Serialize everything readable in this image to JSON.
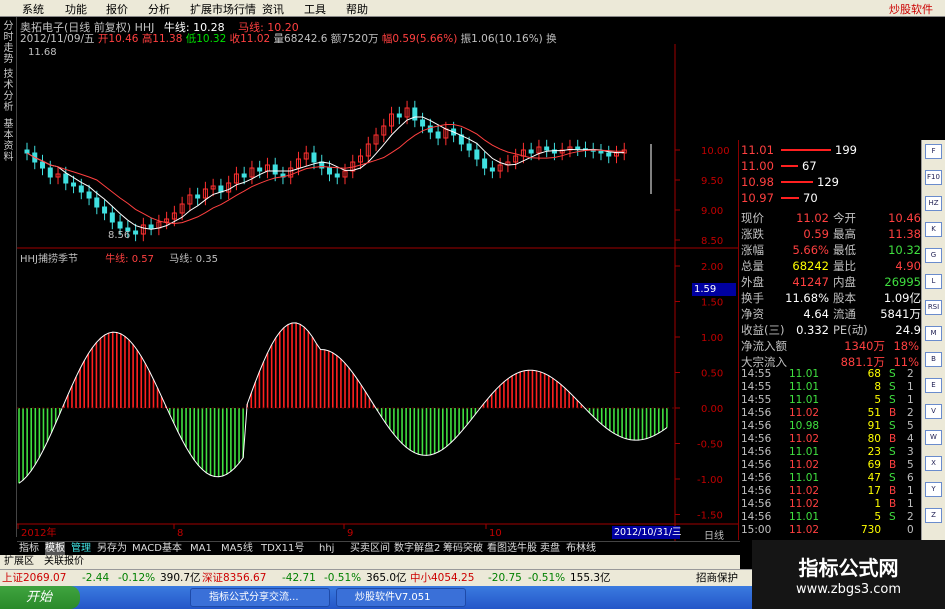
{
  "menu": {
    "items": [
      "系统",
      "功能",
      "报价",
      "分析",
      "扩展市场行情",
      "资讯",
      "工具",
      "帮助"
    ],
    "brand": "炒股软件"
  },
  "info_line1": {
    "stock": "奥拓电子(日线 前复权) HHJ",
    "ma_label": "牛线: 10.28",
    "ma2_label": "马线: 10.20"
  },
  "info_line2": {
    "date": "2012/11/09/五",
    "open": "开10.46",
    "high": "高11.38",
    "low": "低10.32",
    "close": "收11.02",
    "volume": "量68242.6",
    "amount": "额7520万",
    "change": "幅0.59(5.66%)",
    "amplitude": "振1.06(10.16%)",
    "extra": "换"
  },
  "left_tabs": [
    "分时走势",
    "技术分析",
    "基本资料"
  ],
  "price_axis": [
    "10.00",
    "9.50",
    "9.00",
    "8.50"
  ],
  "indicator_axis": [
    "2.00",
    "1.50",
    "1.00",
    "0.50",
    "0.00",
    "-0.50",
    "-1.00",
    "-1.50"
  ],
  "indicator_current": "1.59",
  "chart_labels": {
    "high_mark": "11.68",
    "low_mark": "8.56",
    "indicator_title": "HHJ捕捞季节",
    "ind_bull": "牛线: 0.57",
    "ind_horse": "马线: 0.35"
  },
  "x_axis": {
    "labels": [
      "2012年",
      "8",
      "9",
      "10"
    ],
    "date_box": "2012/10/31/三",
    "period": "日线"
  },
  "order_book": [
    {
      "price": "11.01",
      "vol": "199"
    },
    {
      "price": "11.00",
      "vol": "67"
    },
    {
      "price": "10.98",
      "vol": "129"
    },
    {
      "price": "10.97",
      "vol": "70"
    }
  ],
  "quote": [
    {
      "l1": "现价",
      "v1": "11.02",
      "l2": "今开",
      "v2": "10.46"
    },
    {
      "l1": "涨跌",
      "v1": "0.59",
      "l2": "最高",
      "v2": "11.38"
    },
    {
      "l1": "涨幅",
      "v1": "5.66%",
      "l2": "最低",
      "v2": "10.32"
    },
    {
      "l1": "总量",
      "v1": "68242",
      "l2": "量比",
      "v2": "4.90"
    },
    {
      "l1": "外盘",
      "v1": "41247",
      "l2": "内盘",
      "v2": "26995"
    }
  ],
  "quote2": [
    {
      "l1": "换手",
      "v1": "11.68%",
      "l2": "股本",
      "v2": "1.09亿"
    },
    {
      "l1": "净资",
      "v1": "4.64",
      "l2": "流通",
      "v2": "5841万"
    },
    {
      "l1": "收益(三)",
      "v1": "0.332",
      "l2": "PE(动)",
      "v2": "24.9"
    }
  ],
  "flows": [
    {
      "label": "净流入额",
      "value": "1340万",
      "pct": "18%"
    },
    {
      "label": "大宗流入",
      "value": "881.1万",
      "pct": "11%"
    }
  ],
  "ticks": [
    {
      "t": "14:55",
      "p": "11.01",
      "v": "68",
      "s": "S",
      "n": "2"
    },
    {
      "t": "14:55",
      "p": "11.01",
      "v": "8",
      "s": "S",
      "n": "1"
    },
    {
      "t": "14:55",
      "p": "11.01",
      "v": "5",
      "s": "S",
      "n": "1"
    },
    {
      "t": "14:56",
      "p": "11.02",
      "v": "51",
      "s": "B",
      "n": "2"
    },
    {
      "t": "14:56",
      "p": "10.98",
      "v": "91",
      "s": "S",
      "n": "5"
    },
    {
      "t": "14:56",
      "p": "11.02",
      "v": "80",
      "s": "B",
      "n": "4"
    },
    {
      "t": "14:56",
      "p": "11.01",
      "v": "23",
      "s": "S",
      "n": "3"
    },
    {
      "t": "14:56",
      "p": "11.02",
      "v": "69",
      "s": "B",
      "n": "5"
    },
    {
      "t": "14:56",
      "p": "11.01",
      "v": "47",
      "s": "S",
      "n": "6"
    },
    {
      "t": "14:56",
      "p": "11.02",
      "v": "17",
      "s": "B",
      "n": "1"
    },
    {
      "t": "14:56",
      "p": "11.02",
      "v": "1",
      "s": "B",
      "n": "1"
    },
    {
      "t": "14:56",
      "p": "11.01",
      "v": "5",
      "s": "S",
      "n": "2"
    },
    {
      "t": "15:00",
      "p": "11.02",
      "v": "730",
      "s": "",
      "n": "0"
    }
  ],
  "tabs": [
    "指标",
    "模板",
    "管理",
    "另存为",
    "MACD基本",
    "MA1",
    "MA5线",
    "TDX11号",
    "hhj",
    "买卖区间",
    "数字解盘2",
    "筹码突破",
    "看图选牛股",
    "卖盘",
    "布林线"
  ],
  "subtabs": [
    "扩展区",
    "关联报价"
  ],
  "status": {
    "sh": "上证2069.07",
    "sh_chg": "-2.44",
    "sh_pct": "-0.12%",
    "sh_amt": "390.7亿",
    "sz": "深证8356.67",
    "sz_chg": "-42.71",
    "sz_pct": "-0.51%",
    "sz_amt": "365.0亿",
    "zx": "中小4054.25",
    "zx_chg": "-20.75",
    "zx_pct": "-0.51%",
    "zx_amt": "155.3亿",
    "right": "招商保护"
  },
  "taskbar": {
    "start": "开始",
    "tasks": [
      "指标公式分享交流...",
      "炒股软件V7.051"
    ]
  },
  "watermark": {
    "line1": "指标公式网",
    "line2": "www.zbgs3.com"
  },
  "right_tool_icons": [
    "F",
    "F10",
    "HZ",
    "K",
    "G",
    "L",
    "RSI",
    "M",
    "B",
    "E",
    "V",
    "W",
    "X",
    "Y",
    "Z"
  ],
  "chart_data": {
    "type": "candlestick+histogram",
    "price_ylim": [
      8.5,
      10.0
    ],
    "indicator_ylim": [
      -1.5,
      2.0
    ]
  }
}
